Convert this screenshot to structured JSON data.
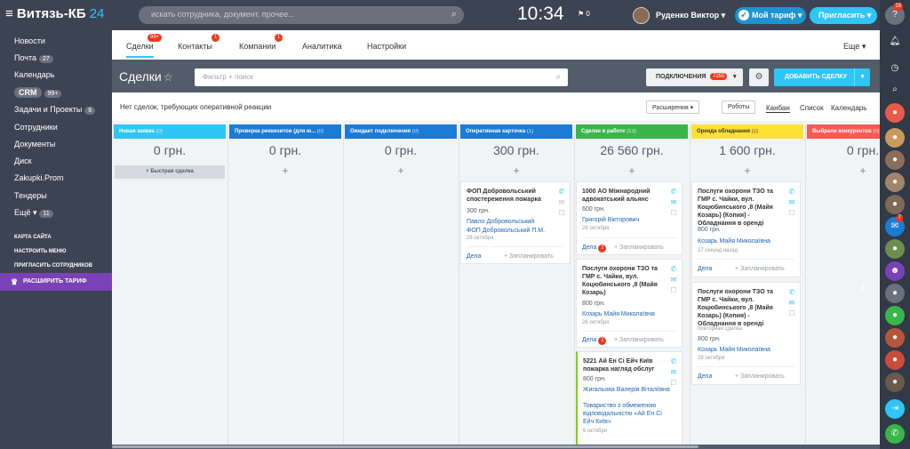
{
  "topbar": {
    "logo": "Витязь-КБ",
    "logo_num": "24",
    "search_placeholder": "искать сотрудника, документ, прочее...",
    "clock": "10:34",
    "flag_count": "0",
    "user_name": "Руденко Виктор",
    "tariff_label": "Мой тариф",
    "invite_label": "Пригласить"
  },
  "sidebar": {
    "items": [
      {
        "label": "Новости"
      },
      {
        "label": "Почта",
        "count": "27"
      },
      {
        "label": "Календарь"
      },
      {
        "label": "CRM",
        "count": "99+"
      },
      {
        "label": "Задачи и Проекты",
        "count": "6"
      },
      {
        "label": "Сотрудники"
      },
      {
        "label": "Документы"
      },
      {
        "label": "Диск"
      },
      {
        "label": "Zakupki.Prom"
      },
      {
        "label": "Тендеры"
      },
      {
        "label": "Ещё",
        "count": "11"
      }
    ],
    "site_map": "КАРТА САЙТА",
    "config_menu": "НАСТРОИТЬ МЕНЮ",
    "invite_staff": "ПРИГЛАСИТЬ СОТРУДНИКОВ",
    "extend_tariff": "РАСШИРИТЬ ТАРИФ"
  },
  "tabs": {
    "deals": "Сделки",
    "deals_badge": "99+",
    "contacts": "Контакты",
    "contacts_badge": "1",
    "companies": "Компании",
    "companies_badge": "1",
    "analytics": "Аналитика",
    "settings": "Настройки",
    "more": "Еще"
  },
  "header": {
    "title": "Сделки",
    "filter_placeholder": "Фильтр + поиск",
    "connections": "ПОДКЛЮЧЕНИЯ",
    "connections_badge": "7255",
    "add_deal": "ДОБАВИТЬ СДЕЛКУ"
  },
  "subbar": {
    "no_deals": "Нет сделок, требующих оперативной реакции",
    "extensions": "Расширения",
    "robots": "Роботы",
    "kanban": "Канбан",
    "list": "Список",
    "calendar": "Календарь"
  },
  "columns": [
    {
      "title": "Новая заявка",
      "count": "(0)",
      "sum": "0 грн.",
      "color": "#2fc6f6",
      "quick": "+ Быстрая сделка"
    },
    {
      "title": "Проверка реквизитов (для ю...",
      "count": "(0)",
      "sum": "0 грн.",
      "color": "#1c7bd4"
    },
    {
      "title": "Ожидает подключения",
      "count": "(0)",
      "sum": "0 грн.",
      "color": "#1c7bd4"
    },
    {
      "title": "Оперативная карточка",
      "count": "(1)",
      "sum": "300 грн.",
      "color": "#1c7bd4"
    },
    {
      "title": "Сделки в работе",
      "count": "(13)",
      "sum": "26 560 грн.",
      "color": "#39b54a"
    },
    {
      "title": "Оренда обладнання",
      "count": "(2)",
      "sum": "1 600 грн.",
      "color": "#ffe034"
    },
    {
      "title": "Выбрали конкурентов",
      "count": "(0)",
      "sum": "0 грн.",
      "color": "#ff5752"
    }
  ],
  "cards": {
    "c1": {
      "title": "ФОП Добровольський спостереження пожарка",
      "price": "300 грн.",
      "contact": "Павло Добровольський",
      "company": "ФОП Добровольський П.М.",
      "date": "28 октября",
      "deals": "Дела",
      "plan": "+ Запланировать"
    },
    "c2": {
      "title": "1000 АО Міжнародний адвокатський альянс",
      "price": "600 грн.",
      "contact": "Григорій Вікторович",
      "date": "26 октября",
      "deals": "Дела",
      "badge": "1",
      "plan": "+ Запланировать"
    },
    "c3": {
      "title": "Послуги охорони ТЗО та ГМР с. Чайки, вул. Коцюбинського ,8 (Майя Козарь)",
      "price": "800 грн.",
      "contact": "Козарь Майя Миколаївна",
      "date": "26 октября",
      "deals": "Дела",
      "badge": "1",
      "plan": "+ Запланировать"
    },
    "c4": {
      "title": "5221 Ай Ен Сі Ейч Київ пожарка нагляд обслуг",
      "price": "800 грн.",
      "contact": "Жигальова Валерія Віталіївна",
      "company": "Товариство з обмеженою відповідальністю «Ай Ен Сі Ейч Київ»",
      "date": "6 октября"
    },
    "c5": {
      "title": "Послуги охорони ТЗО та ГМР с. Чайки, вул. Коцюбинського ,8 (Майя Козарь) (Копия) - Обладнання в оренді",
      "price": "800 грн.",
      "contact": "Козарь Майя Миколаївна",
      "date": "27 секунд назад",
      "deals": "Дела",
      "plan": "+ Запланировать"
    },
    "c6": {
      "title": "Послуги охорони ТЗО та ГМР с. Чайки, вул. Коцюбинського ,8 (Майя Козарь) (Копия) - Обладнання в оренді",
      "note": "повторная сделка",
      "price": "800 грн.",
      "contact": "Козарь Майя Миколаївна",
      "date": "28 октября",
      "deals": "Дела",
      "plan": "+ Запланировать"
    }
  },
  "rail": {
    "notif_badge": "18",
    "chat_badge": "7"
  }
}
